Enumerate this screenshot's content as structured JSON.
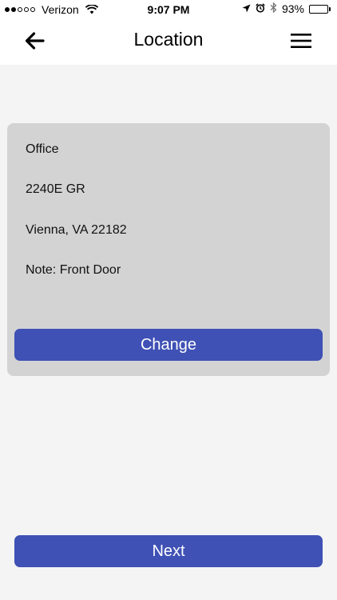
{
  "status_bar": {
    "carrier": "Verizon",
    "time": "9:07 PM",
    "battery_percent": "93%",
    "battery_level": 0.93,
    "signal_bars_filled": 2,
    "signal_bars_total": 5,
    "icons": [
      "wifi-icon",
      "location-arrow-icon",
      "alarm-icon",
      "bluetooth-icon",
      "battery-icon"
    ]
  },
  "nav": {
    "title": "Location",
    "back_icon": "back-arrow-icon",
    "menu_icon": "hamburger-menu-icon"
  },
  "location": {
    "name": "Office",
    "street": "2240E GR",
    "city_state_zip": "Vienna, VA 22182",
    "note": "Note: Front Door",
    "change_label": "Change"
  },
  "footer": {
    "next_label": "Next"
  },
  "colors": {
    "background": "#f4f4f4",
    "card": "#d3d3d3",
    "accent": "#3f51b5",
    "header": "#ffffff"
  }
}
